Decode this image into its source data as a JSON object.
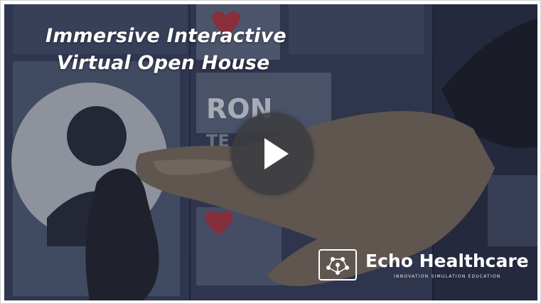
{
  "video": {
    "title_line1": "Immersive Interactive",
    "title_line2": "Virtual Open House",
    "brand_name": "Echo Healthcare",
    "brand_tagline": "INNOVATION  SIMULATION  EDUCATION",
    "play_icon": "play-icon",
    "logo_icon": "echo-molecule-logo-icon"
  },
  "scene_text": {
    "screen_name": "RON",
    "screen_sub": "TE"
  },
  "colors": {
    "background": "#262b40",
    "screen_panel": "#5d6980",
    "heart": "#c0313c",
    "play_button": "#3c3c40",
    "text": "#ffffff"
  }
}
